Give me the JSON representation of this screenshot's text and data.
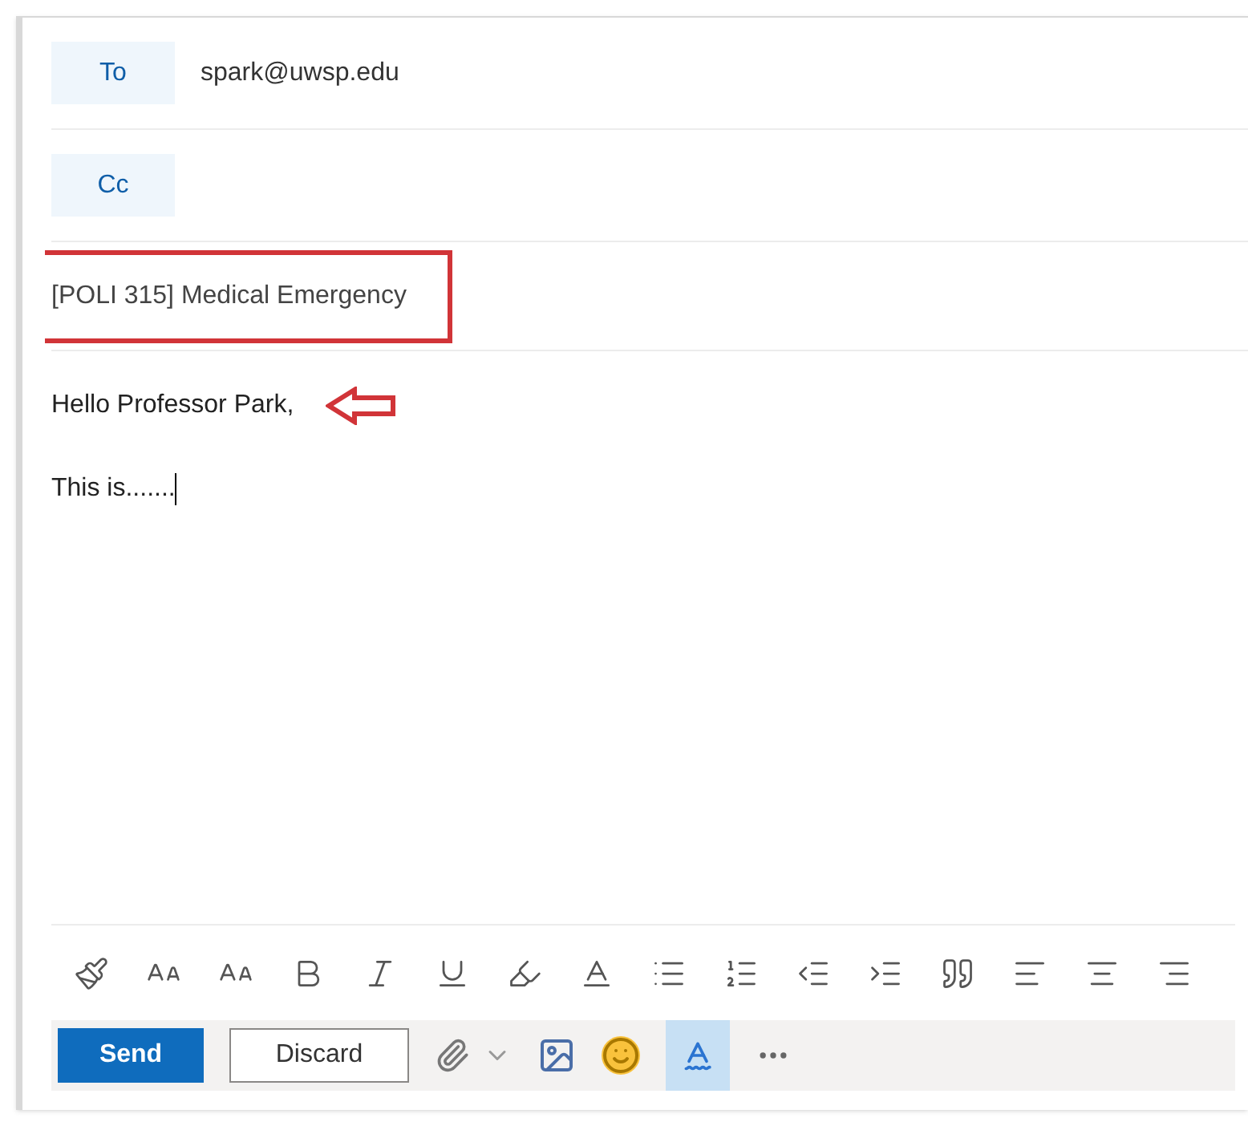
{
  "recipients": [
    {
      "label": "To",
      "value": "spark@uwsp.edu"
    },
    {
      "label": "Cc"
    }
  ],
  "subject": {
    "value": "[POLI 315] Medical Emergency",
    "highlighted": true
  },
  "body": {
    "lines": [
      {
        "text": "Hello Professor Park,",
        "arrow": true
      },
      {
        "text": "This is.......",
        "arrow": false
      }
    ]
  },
  "actions": {
    "send": "Send",
    "discard": "Discard",
    "editor_tool_on": true
  }
}
